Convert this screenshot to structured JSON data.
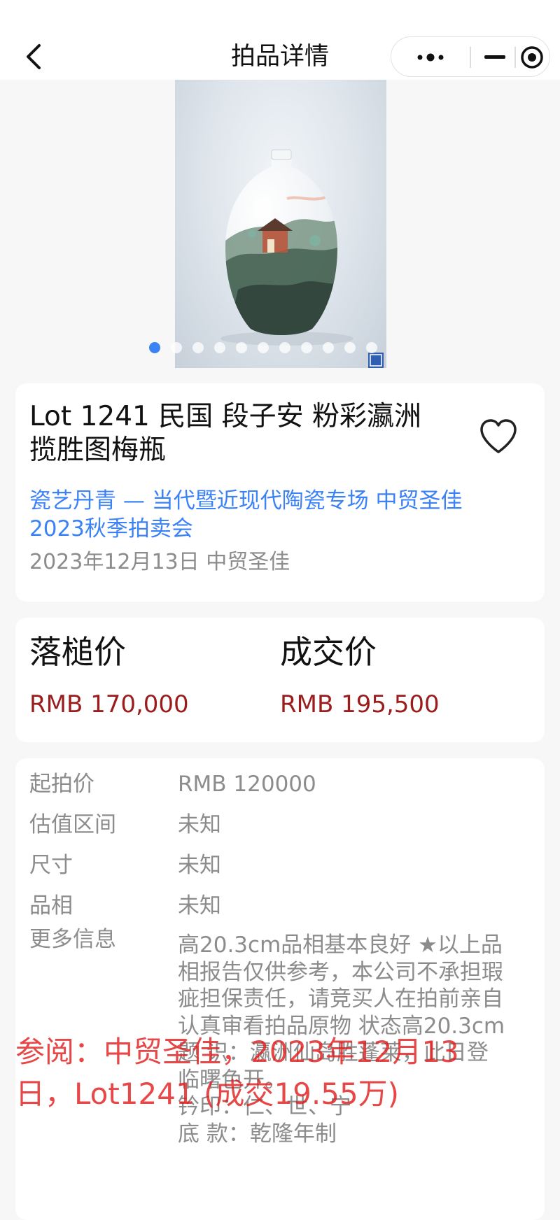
{
  "header": {
    "title": "拍品详情",
    "back_icon": "chevron-left-icon",
    "more_icon": "more-dots-icon",
    "minimize_icon": "minus-icon",
    "close_icon": "target-close-icon"
  },
  "gallery": {
    "image": "vase-photo",
    "dots_total": 11,
    "active_index": 0
  },
  "lot": {
    "title": "Lot 1241 民国 段子安 粉彩瀛洲揽胜图梅瓶",
    "title_line1": "Lot 1241 民国 段子安 粉彩瀛洲",
    "title_line2": "揽胜图梅瓶",
    "auction_line1": "瓷艺丹青 — 当代暨近现代陶瓷专场 中贸圣佳",
    "auction_line2": "2023秋季拍卖会",
    "date_house": "2023年12月13日 中贸圣佳",
    "favorite_icon": "heart-outline-icon"
  },
  "prices": {
    "hammer_label": "落槌价",
    "hammer_value": "RMB 170,000",
    "deal_label": "成交价",
    "deal_value": "RMB 195,500"
  },
  "details": {
    "rows": [
      {
        "key": "起拍价",
        "value": "RMB 120000"
      },
      {
        "key": "估值区间",
        "value": "未知"
      },
      {
        "key": "尺寸",
        "value": "未知"
      },
      {
        "key": "品相",
        "value": "未知"
      }
    ],
    "more_label": "更多信息",
    "more_lines": [
      "高20.3cm品相基本良好 ★以上品",
      "相报告仅供参考，本公司不承担瑕",
      "疵担保责任，请竞买人在拍前亲自",
      "认真审看拍品原物 状态高20.3cm",
      "题 识：瀛洲仙岛胜蓬莱，此日登",
      "临曙色开。",
      "钤印：仁、世、宁",
      "底 款：乾隆年制"
    ]
  },
  "overlay": {
    "line1": "参阅：中贸圣佳，2023年12月13",
    "line2": "日，Lot1241 (成交19.55万)"
  },
  "colors": {
    "accent_blue": "#3b82f6",
    "price_red": "#9b1c1c",
    "overlay_red": "#e21e1e",
    "muted_gray": "#8c8c8c"
  }
}
